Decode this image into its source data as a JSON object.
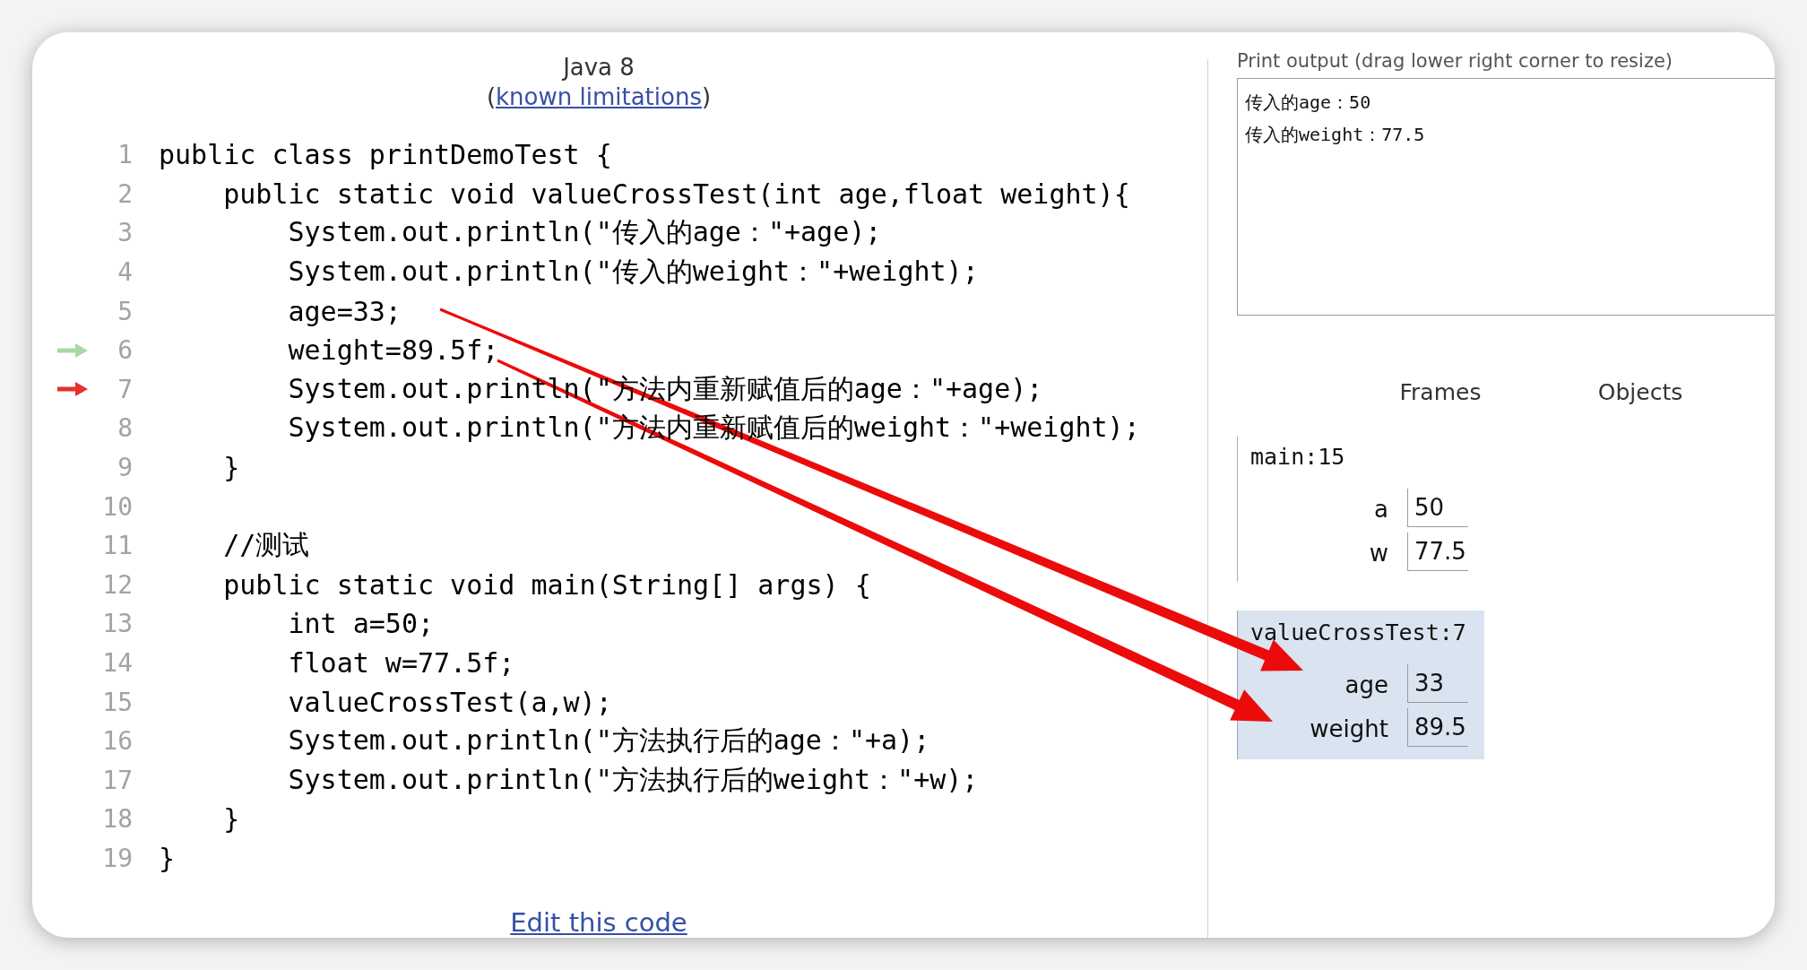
{
  "code_panel": {
    "language": "Java 8",
    "limitations_note": {
      "prefix": "(",
      "link": "known limitations",
      "suffix": ")"
    },
    "lines": [
      {
        "number": "1",
        "text": "public class printDemoTest {",
        "just_executed": false,
        "next_to_execute": false
      },
      {
        "number": "2",
        "text": "    public static void valueCrossTest(int age,float weight){",
        "just_executed": false,
        "next_to_execute": false
      },
      {
        "number": "3",
        "text": "        System.out.println(\"传入的age：\"+age);",
        "just_executed": false,
        "next_to_execute": false
      },
      {
        "number": "4",
        "text": "        System.out.println(\"传入的weight：\"+weight);",
        "just_executed": false,
        "next_to_execute": false
      },
      {
        "number": "5",
        "text": "        age=33;",
        "just_executed": false,
        "next_to_execute": false
      },
      {
        "number": "6",
        "text": "        weight=89.5f;",
        "just_executed": true,
        "next_to_execute": false
      },
      {
        "number": "7",
        "text": "        System.out.println(\"方法内重新赋值后的age：\"+age);",
        "just_executed": false,
        "next_to_execute": true
      },
      {
        "number": "8",
        "text": "        System.out.println(\"方法内重新赋值后的weight：\"+weight);",
        "just_executed": false,
        "next_to_execute": false
      },
      {
        "number": "9",
        "text": "    }",
        "just_executed": false,
        "next_to_execute": false
      },
      {
        "number": "10",
        "just_executed": false,
        "next_to_execute": false
      },
      {
        "number": "11",
        "text": "    //测试",
        "just_executed": false,
        "next_to_execute": false
      },
      {
        "number": "12",
        "text": "    public static void main(String[] args) {",
        "just_executed": false,
        "next_to_execute": false
      },
      {
        "number": "13",
        "text": "        int a=50;",
        "just_executed": false,
        "next_to_execute": false
      },
      {
        "number": "14",
        "text": "        float w=77.5f;",
        "just_executed": false,
        "next_to_execute": false
      },
      {
        "number": "15",
        "text": "        valueCrossTest(a,w);",
        "just_executed": false,
        "next_to_execute": false
      },
      {
        "number": "16",
        "text": "        System.out.println(\"方法执行后的age：\"+a);",
        "just_executed": false,
        "next_to_execute": false
      },
      {
        "number": "17",
        "text": "        System.out.println(\"方法执行后的weight：\"+w);",
        "just_executed": false,
        "next_to_execute": false
      },
      {
        "number": "18",
        "text": "    }",
        "just_executed": false,
        "next_to_execute": false
      },
      {
        "number": "19",
        "text": "}",
        "just_executed": false,
        "next_to_execute": false
      }
    ],
    "edit_link": "Edit this code"
  },
  "print_output": {
    "label": "Print output (drag lower right corner to resize)",
    "lines": [
      "传入的age：50",
      "传入的weight：77.5"
    ]
  },
  "visualizer": {
    "columns": [
      "Frames",
      "Objects"
    ],
    "frames": [
      {
        "name": "main:15",
        "highlighted": false,
        "variables": [
          {
            "name": "a",
            "value": "50"
          },
          {
            "name": "w",
            "value": "77.5"
          }
        ]
      },
      {
        "name": "valueCrossTest:7",
        "highlighted": true,
        "variables": [
          {
            "name": "age",
            "value": "33"
          },
          {
            "name": "weight",
            "value": "89.5"
          }
        ]
      }
    ]
  }
}
